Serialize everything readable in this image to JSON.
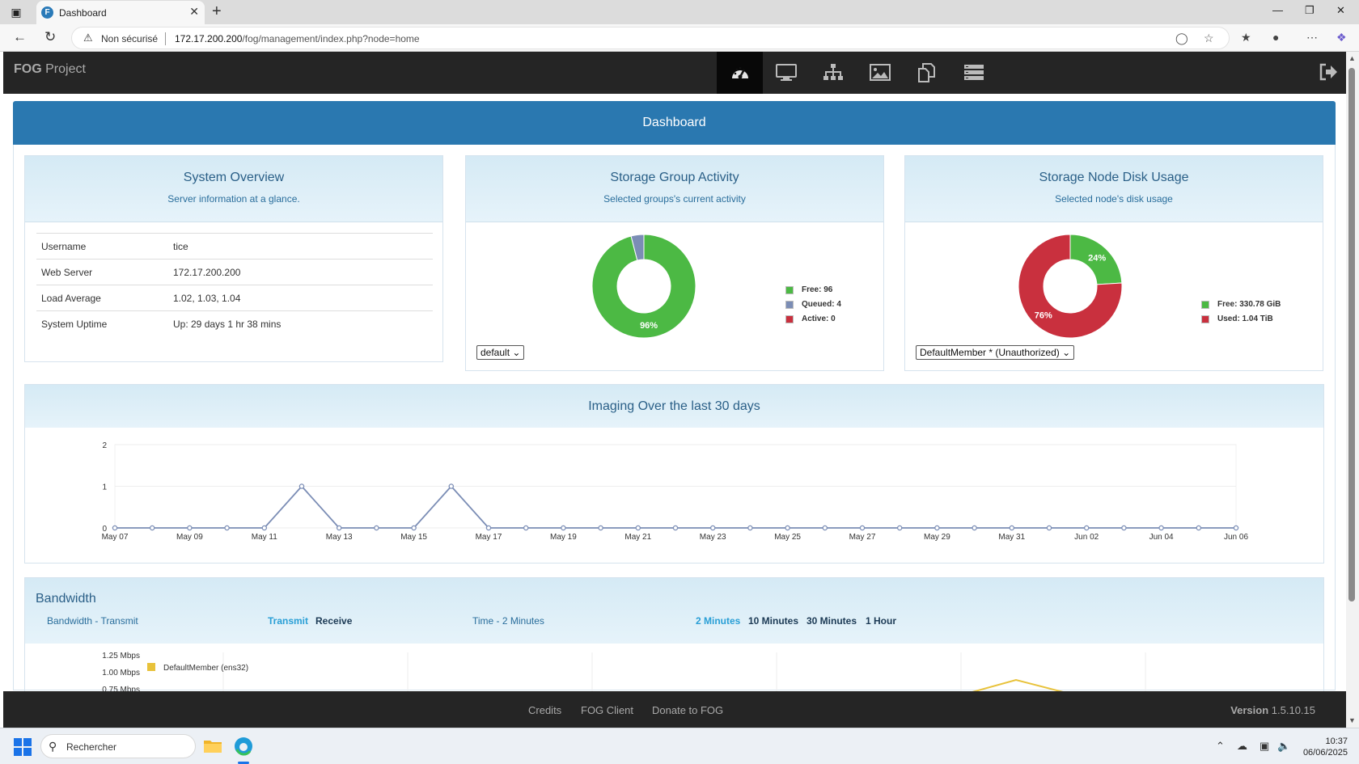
{
  "browser": {
    "tab_title": "Dashboard",
    "tab_favicon": "F",
    "insecure_label": "Non sécurisé",
    "url_host": "172.17.200.200",
    "url_path": "/fog/management/index.php?node=home"
  },
  "header": {
    "brand_bold": "FOG",
    "brand_rest": " Project",
    "menu_icons": [
      "dashboard-icon",
      "hosts-icon",
      "groups-icon",
      "images-icon",
      "snapins-icon",
      "storage-icon"
    ],
    "logout_icon": "logout-icon"
  },
  "dashboard": {
    "title": "Dashboard"
  },
  "system_overview": {
    "title": "System Overview",
    "subtitle": "Server information at a glance.",
    "rows": [
      {
        "key": "Username",
        "value": "tice"
      },
      {
        "key": "Web Server",
        "value": "172.17.200.200"
      },
      {
        "key": "Load Average",
        "value": "1.02, 1.03, 1.04"
      },
      {
        "key": "System Uptime",
        "value": "Up: 29 days 1 hr 38 mins"
      }
    ]
  },
  "storage_group": {
    "title": "Storage Group Activity",
    "subtitle": "Selected groups's current activity",
    "select_value": "default",
    "legend": [
      "Free: 96",
      "Queued: 4",
      "Active: 0"
    ],
    "slice_label": "96%",
    "colors": {
      "free": "#4cb944",
      "queued": "#7b8db5",
      "active": "#c9303e"
    }
  },
  "storage_node": {
    "title": "Storage Node Disk Usage",
    "subtitle": "Selected node's disk usage",
    "select_value": "DefaultMember * (Unauthorized)",
    "legend": [
      "Free: 330.78 GiB",
      "Used: 1.04 TiB"
    ],
    "free_label": "24%",
    "used_label": "76%",
    "colors": {
      "free": "#4cb944",
      "used": "#c9303e"
    }
  },
  "imaging": {
    "title": "Imaging Over the last 30 days"
  },
  "bandwidth": {
    "title": "Bandwidth",
    "sub_label": "Bandwidth - Transmit",
    "transmit": "Transmit",
    "receive": "Receive",
    "time_label": "Time - 2 Minutes",
    "ranges": [
      "2 Minutes",
      "10 Minutes",
      "30 Minutes",
      "1 Hour"
    ],
    "y_ticks": [
      "1.25 Mbps",
      "1.00 Mbps",
      "0.75 Mbps"
    ],
    "legend": "DefaultMember (ens32)",
    "legend_color": "#e8c23a"
  },
  "footer": {
    "links": [
      "Credits",
      "FOG Client",
      "Donate to FOG"
    ],
    "version_label": "Version",
    "version": "1.5.10.15"
  },
  "taskbar": {
    "search_placeholder": "Rechercher",
    "time": "10:37",
    "date": "06/06/2025"
  },
  "chart_data": [
    {
      "type": "pie",
      "title": "Storage Group Activity",
      "labels": [
        "Free",
        "Queued",
        "Active"
      ],
      "values": [
        96,
        4,
        0
      ]
    },
    {
      "type": "pie",
      "title": "Storage Node Disk Usage",
      "labels": [
        "Free",
        "Used"
      ],
      "values": [
        24,
        76
      ]
    },
    {
      "type": "line",
      "title": "Imaging Over the last 30 days",
      "categories": [
        "May 07",
        "May 08",
        "May 09",
        "May 10",
        "May 11",
        "May 12",
        "May 13",
        "May 14",
        "May 15",
        "May 16",
        "May 17",
        "May 18",
        "May 19",
        "May 20",
        "May 21",
        "May 22",
        "May 23",
        "May 24",
        "May 25",
        "May 26",
        "May 27",
        "May 28",
        "May 29",
        "May 30",
        "May 31",
        "Jun 01",
        "Jun 02",
        "Jun 03",
        "Jun 04",
        "Jun 05",
        "Jun 06"
      ],
      "tick_labels": [
        "May 07",
        "May 09",
        "May 11",
        "May 13",
        "May 15",
        "May 17",
        "May 19",
        "May 21",
        "May 23",
        "May 25",
        "May 27",
        "May 29",
        "May 31",
        "Jun 02",
        "Jun 04",
        "Jun 06"
      ],
      "values": [
        0,
        0,
        0,
        0,
        0,
        1,
        0,
        0,
        0,
        1,
        0,
        0,
        0,
        0,
        0,
        0,
        0,
        0,
        0,
        0,
        0,
        0,
        0,
        0,
        0,
        0,
        0,
        0,
        0,
        0,
        0
      ],
      "y_ticks": [
        0,
        1,
        2
      ],
      "ylim": [
        0,
        2
      ],
      "line_color": "#7b8db5"
    }
  ]
}
